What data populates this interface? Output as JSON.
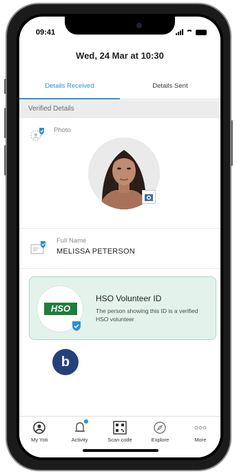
{
  "status_bar": {
    "time": "09:41"
  },
  "header": {
    "date": "Wed, 24 Mar at 10:30"
  },
  "tabs": [
    {
      "label": "Details Received",
      "active": true
    },
    {
      "label": "Details Sent",
      "active": false
    }
  ],
  "section": {
    "label": "Verified Details"
  },
  "photo": {
    "label": "Photo"
  },
  "full_name": {
    "label": "Full Name",
    "value": "MELISSA PETERSON"
  },
  "volunteer_card": {
    "logo_text": "HSO",
    "title": "HSO Volunteer ID",
    "description": "The person showing this ID is a verified HSO volunteer"
  },
  "marker": {
    "label": "b"
  },
  "nav": [
    {
      "label": "My Yoti",
      "icon": "my-yoti-icon"
    },
    {
      "label": "Activity",
      "icon": "bell-icon"
    },
    {
      "label": "Scan code",
      "icon": "qr-code-icon"
    },
    {
      "label": "Explore",
      "icon": "compass-icon"
    },
    {
      "label": "More",
      "icon": "more-dots-icon"
    }
  ],
  "colors": {
    "accent": "#2f8fd4",
    "card_bg": "#e3f3ec",
    "hso_green": "#1e7f3b",
    "marker": "#25417a"
  }
}
